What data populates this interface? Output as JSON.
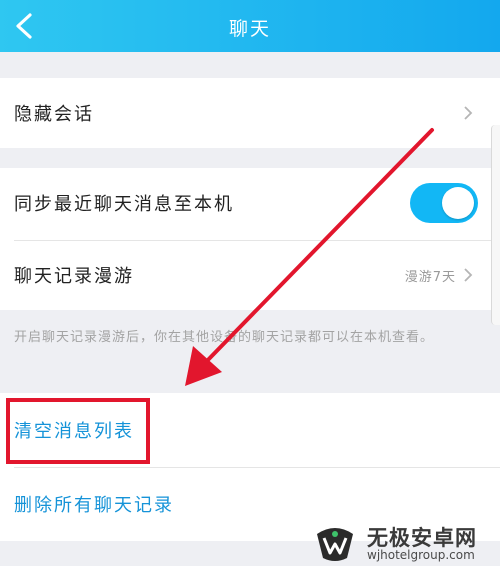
{
  "header": {
    "title": "聊天",
    "back_icon": "chevron-left-icon"
  },
  "rows": {
    "hidden_sessions": {
      "label": "隐藏会话"
    },
    "sync_recent": {
      "label": "同步最近聊天消息至本机",
      "toggle_on": true
    },
    "roaming": {
      "label": "聊天记录漫游",
      "value": "漫游7天"
    }
  },
  "hint": "开启聊天记录漫游后，你在其他设备的聊天记录都可以在本机查看。",
  "actions": {
    "clear_list": "清空消息列表",
    "delete_all": "删除所有聊天记录"
  },
  "watermark": {
    "name": "无极安卓网",
    "url": "wjhotelgroup.com"
  },
  "colors": {
    "accent": "#12b7f5",
    "link": "#1593d8",
    "annotation": "#e2162d"
  }
}
